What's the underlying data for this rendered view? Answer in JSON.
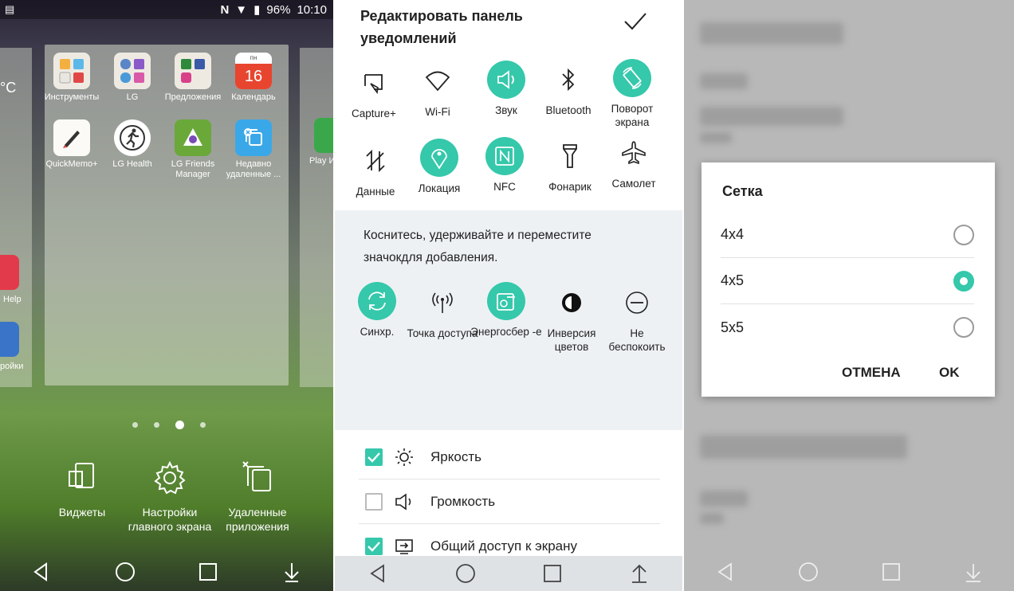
{
  "home": {
    "status": {
      "battery": "96%",
      "time": "10:10"
    },
    "left_partial": {
      "temp": "°C",
      "help": "Help",
      "settings": "ройки"
    },
    "apps": [
      {
        "label": "Инструменты",
        "icon": "folder-tools-icon"
      },
      {
        "label": "LG",
        "icon": "folder-lg-icon"
      },
      {
        "label": "Предложения",
        "icon": "folder-offers-icon"
      },
      {
        "label": "Календарь",
        "icon": "calendar-icon",
        "day": "пн",
        "date": "16"
      },
      {
        "label": "QuickMemo+",
        "icon": "pen-icon"
      },
      {
        "label": "LG Health",
        "icon": "running-icon"
      },
      {
        "label": "LG Friends Manager",
        "icon": "lg-friends-icon"
      },
      {
        "label": "Недавно удаленные ...",
        "icon": "recently-deleted-icon"
      }
    ],
    "right_partial": {
      "label": "Play И"
    },
    "options": [
      {
        "label": "Виджеты",
        "icon": "widgets-icon"
      },
      {
        "label": "Настройки главного экрана",
        "icon": "gear-icon"
      },
      {
        "label": "Удаленные приложения",
        "icon": "deleted-apps-icon"
      }
    ]
  },
  "notif_edit": {
    "title": "Редактировать панель уведомлений",
    "active_tiles": [
      {
        "label": "Capture+",
        "icon": "capture-icon",
        "on": false
      },
      {
        "label": "Wi-Fi",
        "icon": "wifi-icon",
        "on": false
      },
      {
        "label": "Звук",
        "icon": "sound-icon",
        "on": true
      },
      {
        "label": "Bluetooth",
        "icon": "bluetooth-icon",
        "on": false
      },
      {
        "label": "Поворот экрана",
        "icon": "rotate-icon",
        "on": true
      },
      {
        "label": "Данные",
        "icon": "data-icon",
        "on": false
      },
      {
        "label": "Локация",
        "icon": "location-icon",
        "on": true
      },
      {
        "label": "NFC",
        "icon": "nfc-icon",
        "on": true
      },
      {
        "label": "Фонарик",
        "icon": "flashlight-icon",
        "on": false
      },
      {
        "label": "Самолет",
        "icon": "airplane-icon",
        "on": false
      }
    ],
    "hint": "Коснитесь, удерживайте и переместите значокдля добавления.",
    "extra_tiles": [
      {
        "label": "Синхр.",
        "icon": "sync-icon",
        "on": true
      },
      {
        "label": "Точка доступа",
        "icon": "hotspot-icon",
        "on": false
      },
      {
        "label": "Энергосбер -е",
        "icon": "battery-saver-icon",
        "on": true
      },
      {
        "label": "Инверсия цветов",
        "icon": "invert-colors-icon",
        "on": false
      },
      {
        "label": "Не беспокоить",
        "icon": "do-not-disturb-icon",
        "on": false
      }
    ],
    "rows": [
      {
        "label": "Яркость",
        "checked": true,
        "icon": "brightness-icon"
      },
      {
        "label": "Громкость",
        "checked": false,
        "icon": "volume-icon"
      },
      {
        "label": "Общий доступ к экрану",
        "checked": true,
        "icon": "screen-share-icon"
      }
    ]
  },
  "grid_dialog": {
    "title": "Сетка",
    "options": [
      "4x4",
      "4x5",
      "5x5"
    ],
    "selected": "4x5",
    "cancel": "ОТМЕНА",
    "ok": "OK"
  },
  "colors": {
    "accent": "#35c8ab"
  }
}
